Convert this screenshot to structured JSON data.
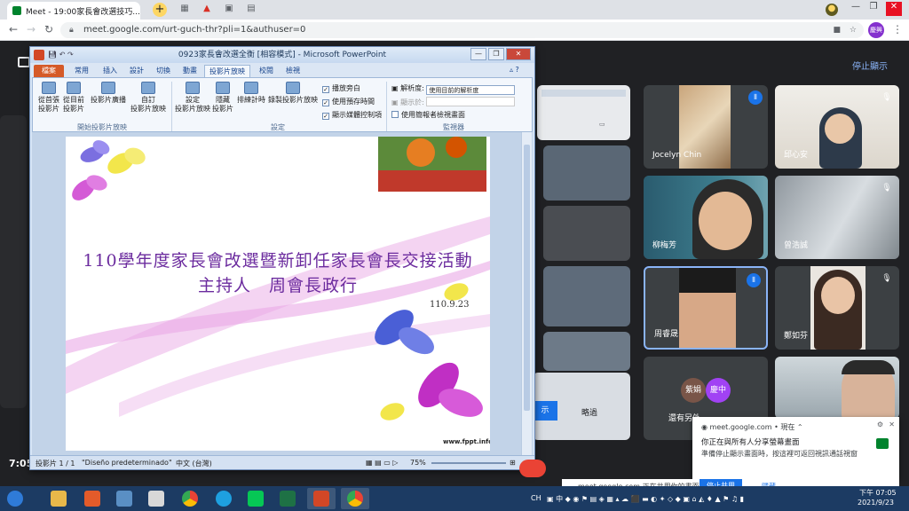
{
  "browser": {
    "tab_title": "Meet - 19:00家長會改選技巧...",
    "address": "meet.google.com/urt-guch-thr?pli=1&authuser=0",
    "profile_label": "慶興"
  },
  "meet": {
    "stop_presenting": "停止顯示",
    "participants": [
      {
        "name": "Jocelyn Chin"
      },
      {
        "name": "邱心安"
      },
      {
        "name": "柳梅芳"
      },
      {
        "name": "曾浩誠"
      },
      {
        "name": "周睿晟"
      },
      {
        "name": "鄭如芬"
      },
      {
        "name": "還有另外…"
      }
    ],
    "more_avatars": [
      "紫娟",
      "慶中"
    ],
    "side_label_skip": "略過",
    "side_label_show": "示"
  },
  "ppt": {
    "window_title": "0923家長會改選全衡 [相容模式] - Microsoft PowerPoint",
    "tabs": [
      "檔案",
      "常用",
      "插入",
      "設計",
      "切換",
      "動畫",
      "投影片放映",
      "校閱",
      "檢視"
    ],
    "ribbon": {
      "btn_from_start": "從首張\n投影片",
      "btn_from_current": "從目前\n投影片",
      "btn_broadcast": "投影片廣播",
      "btn_custom": "自訂\n投影片放映",
      "group_start": "開始投影片放映",
      "btn_setup": "設定\n投影片放映",
      "btn_hide": "隱藏\n投影片",
      "btn_rehearse": "排練計時",
      "btn_record": "錄製投影片放映",
      "chk_narration": "播放旁白",
      "chk_timing": "使用預存時間",
      "chk_media": "顯示媒體控制項",
      "group_setup": "設定",
      "resolution_label": "解析度:",
      "resolution_value": "使用目前的解析度",
      "show_on_label": "顯示於:",
      "presenter_view": "使用簡報者檢視畫面",
      "group_monitors": "監視器"
    },
    "slide": {
      "title_line1": "110學年度家長會改選暨新卸任家長會長交接活動",
      "title_line2": "主持人　周會長政行",
      "date": "110.9.23",
      "url": "www.fppt.info"
    },
    "status": {
      "slide_pos": "投影片 1 / 1",
      "theme": "\"Diseño predeterminado\"",
      "lang": "中文 (台灣)",
      "zoom": "75%"
    }
  },
  "notification": {
    "source": "meet.google.com",
    "time": "• 現在",
    "line1": "你正在與所有人分享螢幕畫面",
    "line2": "準備停止顯示畫面時，按這裡可返回視訊通話視窗"
  },
  "share_bar": {
    "text": "meet.google.com 正在共用你的畫面。",
    "stop": "停止共用",
    "hide": "隱藏"
  },
  "taskbar": {
    "ime": "CH",
    "time": "下午 07:05",
    "date": "2021/9/23"
  },
  "left_time": "7:05",
  "colors": {
    "slide_title": "#6b2b9e",
    "meet_blue": "#1a73e8",
    "ppt_file_tab": "#d55a28"
  }
}
